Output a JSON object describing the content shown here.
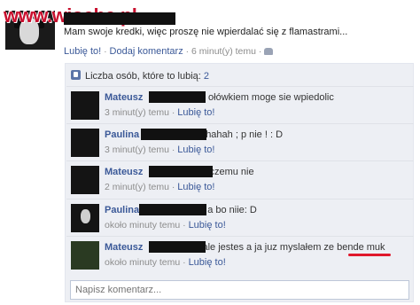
{
  "watermark": "www.wiocha.pl",
  "post": {
    "text": "Mam swoje kredki, więc proszę nie wpierdalać się z flamastrami...",
    "actions": {
      "like": "Lubię to!",
      "sep1": " · ",
      "comment": "Dodaj komentarz",
      "sep2": " · ",
      "time": "6 minut(y) temu",
      "sep3": " · "
    }
  },
  "likes": {
    "label": "Liczba osób, które to lubią:",
    "count": "2"
  },
  "comments": [
    {
      "name": "Mateusz",
      "text": "z ołówkiem moge sie wpiedolic",
      "time": "3 minut(y) temu",
      "like": "Lubię to!",
      "sep": " · "
    },
    {
      "name": "Paulina",
      "text": "hahah ; p nie ! : D",
      "time": "3 minut(y) temu",
      "like": "Lubię to!",
      "sep": " · "
    },
    {
      "name": "Mateusz",
      "text": "czemu nie",
      "time": "2 minut(y) temu",
      "like": "Lubię to!",
      "sep": " · "
    },
    {
      "name": "Paulina",
      "text": "a bo niie: D",
      "time": "około minuty temu",
      "like": "Lubię to!",
      "sep": " · "
    },
    {
      "name": "Mateusz",
      "text": "ale jestes a ja juz myslałem ze",
      "text_underlined": "bende muk",
      "time": "około minuty temu",
      "like": "Lubię to!",
      "sep": " · "
    }
  ],
  "input": {
    "placeholder": "Napisz komentarz..."
  },
  "colors": {
    "link": "#3b5998",
    "box_bg": "#edeff4",
    "underline": "#e0182c",
    "watermark": "#c8102e"
  }
}
